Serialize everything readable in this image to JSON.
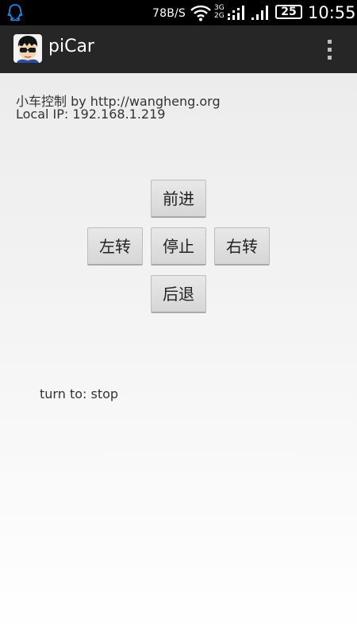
{
  "status_bar": {
    "net_speed": "78B/S",
    "net_3g": "3G",
    "net_2g": "2G",
    "battery": "25",
    "time": "10:55",
    "icons": [
      "qq-icon",
      "wifi-icon",
      "network-3g2g-icon",
      "signal-icon",
      "battery-icon"
    ]
  },
  "action_bar": {
    "title": "piCar",
    "icon": "app-avatar-icon",
    "menu_icon": "overflow-menu-icon"
  },
  "main": {
    "title_line": "小车控制 by http://wangheng.org",
    "ip_line": "Local IP: 192.168.1.219",
    "buttons": {
      "forward": "前进",
      "left": "左转",
      "stop": "停止",
      "right": "右转",
      "backward": "后退"
    },
    "turn_status": "turn to: stop"
  },
  "colors": {
    "status_bar_bg": "#000000",
    "action_bar_bg": "#262626",
    "content_bg": "#f0f0f0",
    "button_bg": "#dcdcdc"
  }
}
